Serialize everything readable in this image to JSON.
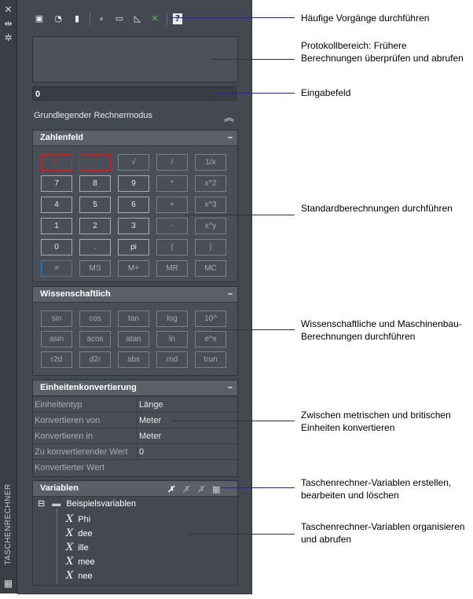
{
  "side_strip": {
    "close_icon": "✕",
    "pin_icon": "⇹",
    "settings_icon": "✲",
    "vertical_title": "TASCHENRECHNER",
    "calc_icon": "▦"
  },
  "toolbar": {
    "icons": [
      "clear-icon",
      "clear-history-icon",
      "paste-icon",
      "get-coordinates-icon",
      "distance-icon",
      "angle-icon",
      "intersection-icon",
      "help-icon"
    ],
    "glyphs": [
      "▣",
      "◔",
      "▮",
      "⸗",
      "▭",
      "◺",
      "✕",
      "?"
    ]
  },
  "input": {
    "value": "0"
  },
  "mode": {
    "label": "Grundlegender Rechnermodus",
    "icon": "︽"
  },
  "number_pad": {
    "title": "Zahlenfeld",
    "collapse": "–",
    "rows": [
      [
        "C",
        "←",
        "√",
        "/",
        "1/x"
      ],
      [
        "7",
        "8",
        "9",
        "*",
        "x^2"
      ],
      [
        "4",
        "5",
        "6",
        "+",
        "x^3"
      ],
      [
        "1",
        "2",
        "3",
        "-",
        "x^y"
      ],
      [
        "0",
        ".",
        "pi",
        "(",
        ")"
      ],
      [
        "=",
        "MS",
        "M+",
        "MR",
        "MC"
      ]
    ]
  },
  "scientific": {
    "title": "Wissenschaftlich",
    "collapse": "–",
    "rows": [
      [
        "sin",
        "cos",
        "tan",
        "log",
        "10^"
      ],
      [
        "asin",
        "acos",
        "atan",
        "ln",
        "e^x"
      ],
      [
        "r2d",
        "d2r",
        "abs",
        "rnd",
        "trun"
      ]
    ]
  },
  "units": {
    "title": "Einheitenkonvertierung",
    "collapse": "–",
    "rows": [
      {
        "label": "Einheitentyp",
        "value": "Länge"
      },
      {
        "label": "Konvertieren von",
        "value": "Meter"
      },
      {
        "label": "Konvertieren in",
        "value": "Meter"
      },
      {
        "label": "Zu konvertierender Wert",
        "value": "0"
      },
      {
        "label": "Konvertierter Wert",
        "value": ""
      }
    ]
  },
  "variables": {
    "title": "Variablen",
    "tool_glyphs": [
      "✗",
      "✗",
      "✗",
      "▦"
    ],
    "tool_icons": [
      "new-variable-icon",
      "edit-variable-icon",
      "delete-variable-icon",
      "calculator-icon"
    ],
    "category": "Beispielsvariablen",
    "expand_glyph": "⊟",
    "items": [
      "Phi",
      "dee",
      "ille",
      "mee",
      "nee"
    ],
    "item_glyph": "X"
  },
  "annotations": [
    "Häufige Vorgänge durchführen",
    "Protokollbereich: Frühere Berechnungen überprüfen und abrufen",
    "Eingabefeld",
    "Standardberechnungen durchführen",
    "Wissenschaftliche und Maschinenbau-Berechnungen durchführen",
    "Zwischen metrischen und britischen Einheiten konvertieren",
    "Taschenrechner-Variablen erstellen, bearbeiten und löschen",
    "Taschenrechner-Variablen organisieren und abrufen"
  ]
}
